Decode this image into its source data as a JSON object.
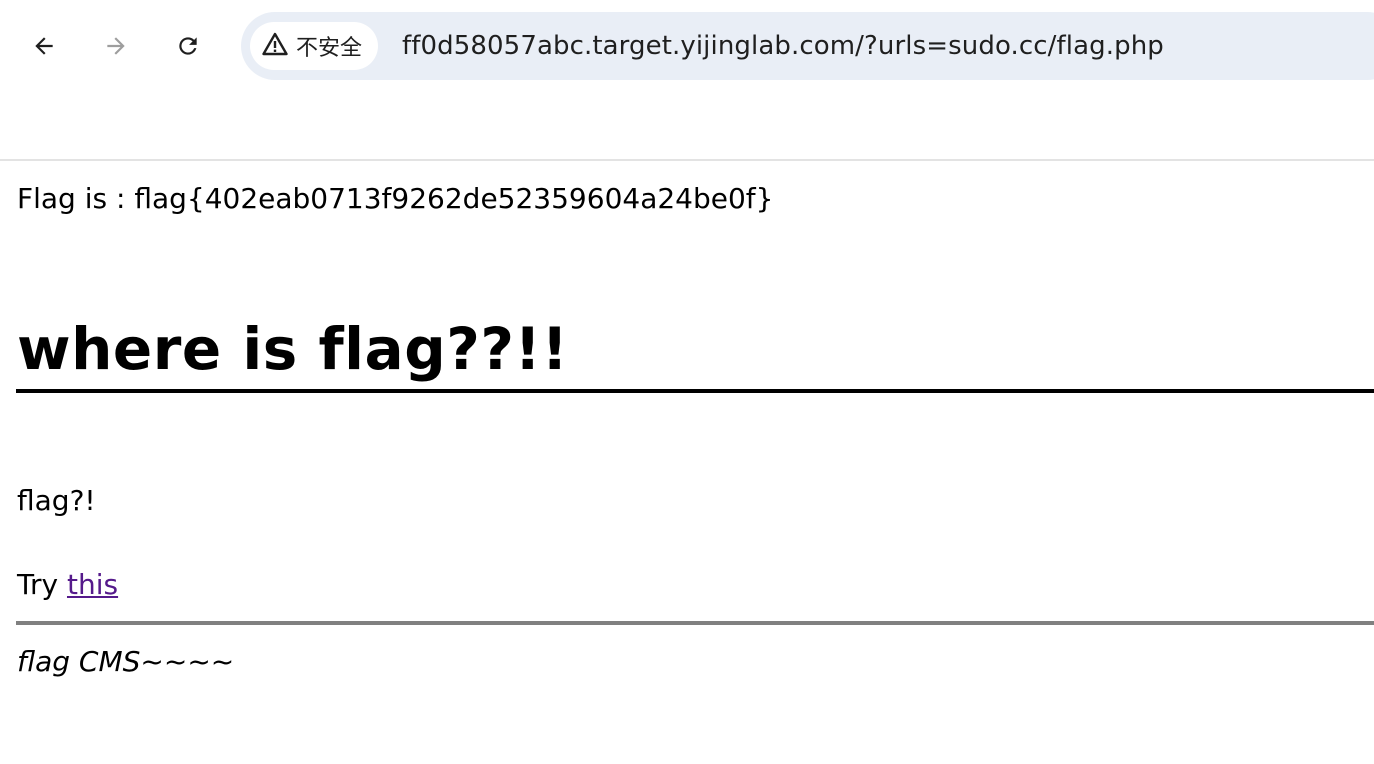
{
  "browser": {
    "security_label": "不安全",
    "url": "ff0d58057abc.target.yijinglab.com/?urls=sudo.cc/flag.php"
  },
  "page": {
    "flag_line": "Flag is : flag{402eab0713f9262de52359604a24be0f}",
    "heading": "where is flag??!!",
    "paragraph": "flag?!",
    "try_prefix": "Try ",
    "try_link": "this",
    "footer": "flag CMS~~~~"
  }
}
